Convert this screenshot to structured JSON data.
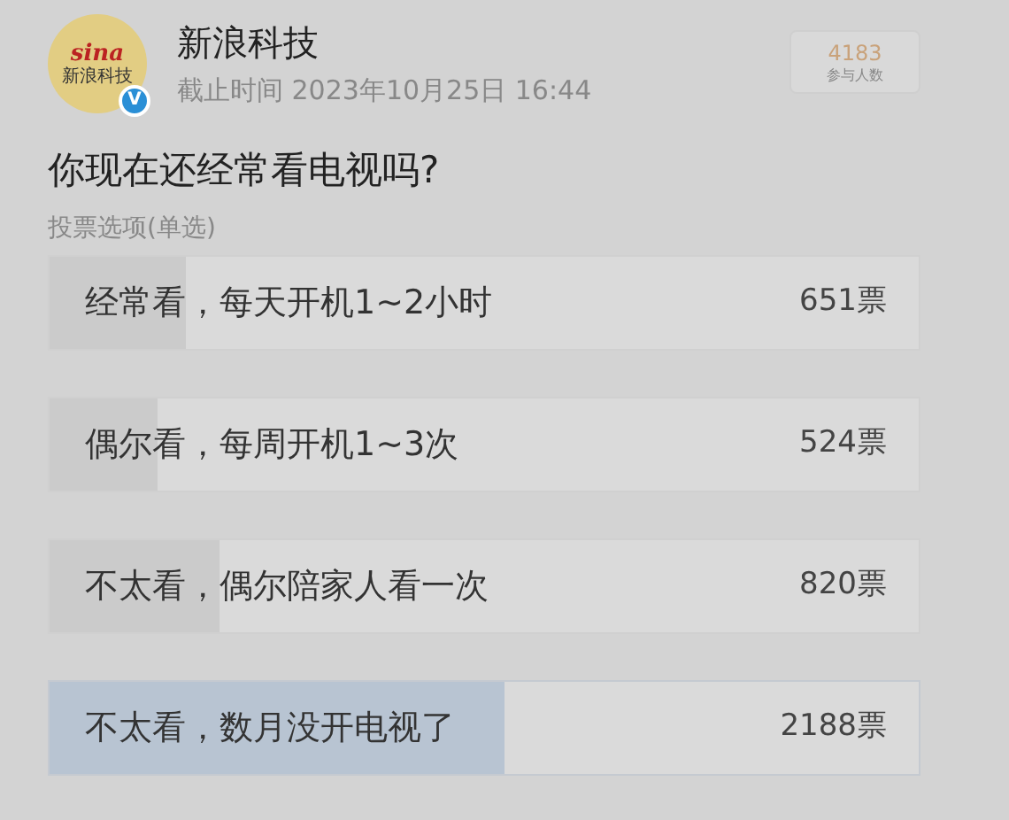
{
  "account": {
    "logo_top": "sina",
    "logo_bottom": "新浪科技",
    "verified_mark": "V",
    "name": "新浪科技",
    "deadline": "截止时间 2023年10月25日 16:44"
  },
  "participants": {
    "count": "4183",
    "label": "参与人数"
  },
  "question": "你现在还经常看电视吗?",
  "poll_type": "投票选项(单选)",
  "options": [
    {
      "label": "经常看，每天开机1~2小时",
      "votes": "651票",
      "level": 0.156,
      "selected": false
    },
    {
      "label": "偶尔看，每周开机1~3次",
      "votes": "524票",
      "level": 0.125,
      "selected": false
    },
    {
      "label": "不太看，偶尔陪家人看一次",
      "votes": "820票",
      "level": 0.196,
      "selected": false
    },
    {
      "label": "不太看，数月没开电视了",
      "votes": "2188票",
      "level": 0.523,
      "selected": true
    }
  ]
}
